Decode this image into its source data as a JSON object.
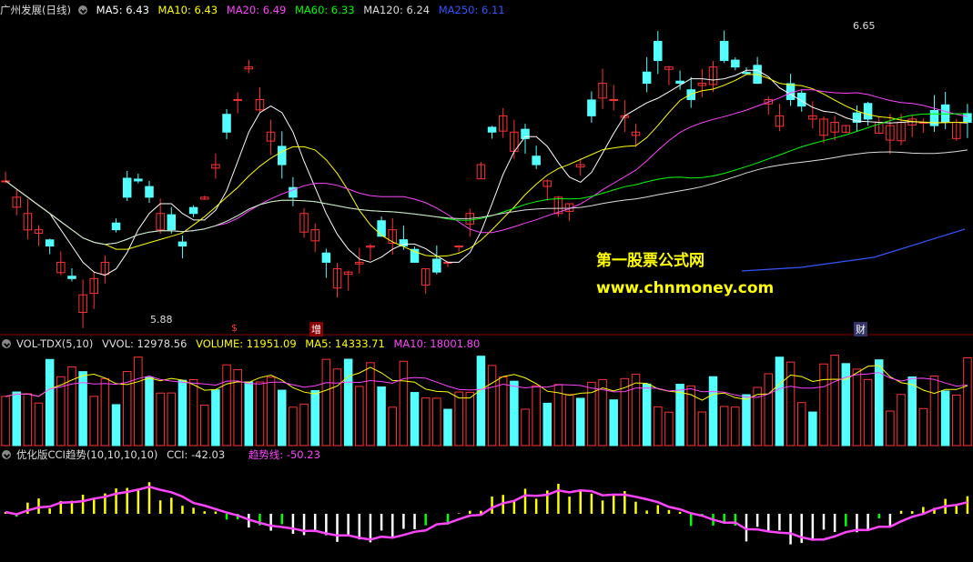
{
  "main_panel": {
    "title": "广州发展(日线)",
    "indicators": [
      {
        "label": "MA5: 6.43",
        "color": "#ffffff"
      },
      {
        "label": "MA10: 6.43",
        "color": "#ffff00"
      },
      {
        "label": "MA20: 6.49",
        "color": "#ff44ff"
      },
      {
        "label": "MA60: 6.33",
        "color": "#00ff00"
      },
      {
        "label": "MA120: 6.24",
        "color": "#dddddd"
      },
      {
        "label": "MA250: 6.11",
        "color": "#3355ff"
      }
    ],
    "high_label": "6.65",
    "low_label": "5.88",
    "event_tags": [
      "$",
      "增",
      "财"
    ]
  },
  "vol_panel": {
    "title": "VOL-TDX(5,10)",
    "indicators": [
      {
        "label": "VVOL: 12978.56",
        "color": "#dddddd"
      },
      {
        "label": "VOLUME: 11951.09",
        "color": "#ffff00"
      },
      {
        "label": "MA5: 14333.71",
        "color": "#ffff00"
      },
      {
        "label": "MA10: 18001.80",
        "color": "#ff44ff"
      }
    ]
  },
  "cci_panel": {
    "title": "优化版CCI趋势(10,10,10,10)",
    "indicators": [
      {
        "label": "CCI: -42.03",
        "color": "#dddddd"
      },
      {
        "label": "趋势线: -50.23",
        "color": "#ff44ff"
      }
    ]
  },
  "watermark": {
    "line1": "第一股票公式网",
    "line2": "www.chnmoney.com"
  },
  "chart_data": [
    {
      "type": "candlestick",
      "title": "广州发展(日线)",
      "series": [
        {
          "name": "MA5",
          "last": 6.43
        },
        {
          "name": "MA10",
          "last": 6.43
        },
        {
          "name": "MA20",
          "last": 6.49
        },
        {
          "name": "MA60",
          "last": 6.33
        },
        {
          "name": "MA120",
          "last": 6.24
        },
        {
          "name": "MA250",
          "last": 6.11
        }
      ],
      "annotations": {
        "max": 6.65,
        "min": 5.88
      },
      "ylim": [
        5.8,
        6.75
      ]
    },
    {
      "type": "bar",
      "title": "VOL-TDX(5,10)",
      "series": [
        {
          "name": "VVOL",
          "last": 12978.56
        },
        {
          "name": "VOLUME",
          "last": 11951.09
        },
        {
          "name": "MA5",
          "last": 14333.71
        },
        {
          "name": "MA10",
          "last": 18001.8
        }
      ]
    },
    {
      "type": "bar",
      "title": "优化版CCI趋势(10,10,10,10)",
      "series": [
        {
          "name": "CCI",
          "last": -42.03
        },
        {
          "name": "趋势线",
          "last": -50.23
        }
      ]
    }
  ]
}
